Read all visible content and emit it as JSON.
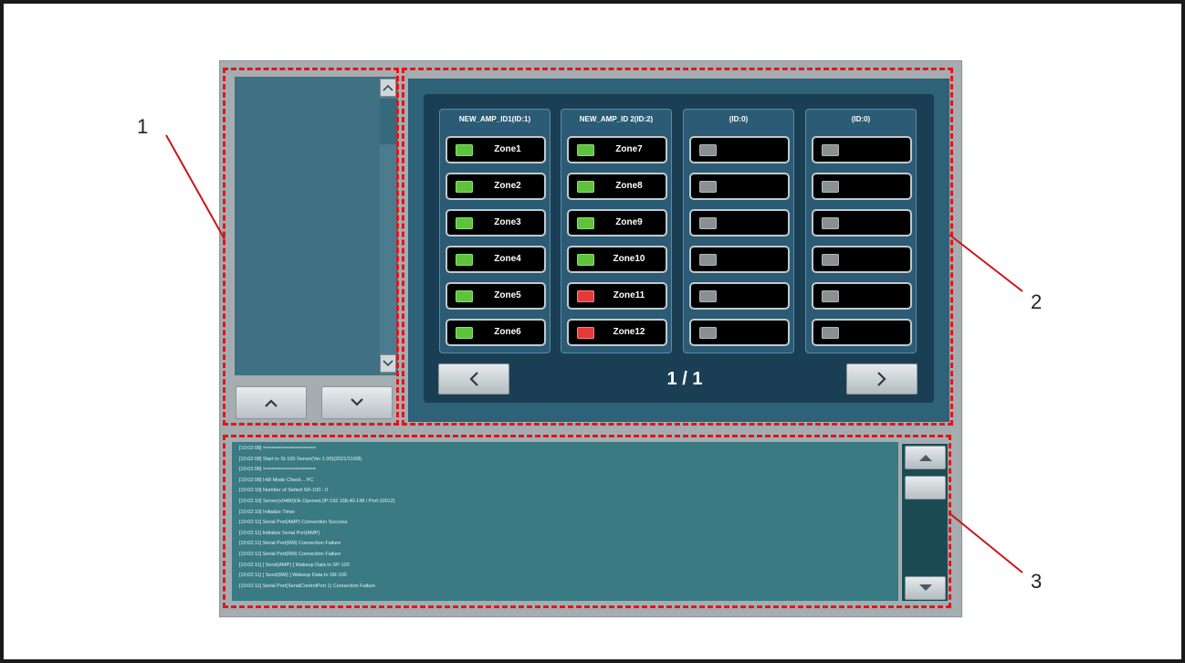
{
  "callouts": {
    "c1": "1",
    "c2": "2",
    "c3": "3"
  },
  "amp_columns": [
    {
      "header": "NEW_AMP_ID1(ID:1)",
      "zones": [
        {
          "label": "Zone1",
          "status": "green"
        },
        {
          "label": "Zone2",
          "status": "green"
        },
        {
          "label": "Zone3",
          "status": "green"
        },
        {
          "label": "Zone4",
          "status": "green"
        },
        {
          "label": "Zone5",
          "status": "green"
        },
        {
          "label": "Zone6",
          "status": "green"
        }
      ]
    },
    {
      "header": "NEW_AMP_ID 2(ID:2)",
      "zones": [
        {
          "label": "Zone7",
          "status": "green"
        },
        {
          "label": "Zone8",
          "status": "green"
        },
        {
          "label": "Zone9",
          "status": "green"
        },
        {
          "label": "Zone10",
          "status": "green"
        },
        {
          "label": "Zone11",
          "status": "red"
        },
        {
          "label": "Zone12",
          "status": "red"
        }
      ]
    },
    {
      "header": "(ID:0)",
      "zones": [
        {
          "label": "",
          "status": "gray"
        },
        {
          "label": "",
          "status": "gray"
        },
        {
          "label": "",
          "status": "gray"
        },
        {
          "label": "",
          "status": "gray"
        },
        {
          "label": "",
          "status": "gray"
        },
        {
          "label": "",
          "status": "gray"
        }
      ]
    },
    {
      "header": "(ID:0)",
      "zones": [
        {
          "label": "",
          "status": "gray"
        },
        {
          "label": "",
          "status": "gray"
        },
        {
          "label": "",
          "status": "gray"
        },
        {
          "label": "",
          "status": "gray"
        },
        {
          "label": "",
          "status": "gray"
        },
        {
          "label": "",
          "status": "gray"
        }
      ]
    }
  ],
  "pager": {
    "text": "1 / 1",
    "prev_icon": "chevron-left-icon",
    "next_icon": "chevron-right-icon"
  },
  "list": {
    "up_icon": "chevron-up-icon",
    "down_icon": "chevron-down-icon"
  },
  "log_lines": [
    "[10:02:08] ==================",
    "[10:02:08] Start to SI-100 Server(Ver 1.00)(2021/11/08)",
    "[10:02:08] ==================",
    "[10:02:08] HW Mode Check... PC",
    "[10:02:10] Number of Setted SR-100 : 0",
    "[10:02:10] Server(x0480)Ok Opened.(IP:192.168.40.148 / Port:10012)",
    "[10:02:10] Initialize Timer",
    "[10:02:11] Serial Port(AMP) Connection Success",
    "[10:02:11] Initialize Serial Port(AMP)",
    "[10:02:11] Serial Port(RM) Connection Failure",
    "[10:02:11] Serial Port(RM) Connection Failure",
    "[10:02:11] [ Send(AMP) ] Wakeup Data to SP-100",
    "[10:02:11] [ Send(RM) ] Wakeup Data to SR-100",
    "[10:02:11] Serial Port(SerialControlPort 1) Connection Failure"
  ],
  "colors": {
    "accent_red": "#e0161b",
    "led_green": "#5ec33c",
    "led_red": "#e53a3a",
    "led_gray": "#8a8f92"
  }
}
